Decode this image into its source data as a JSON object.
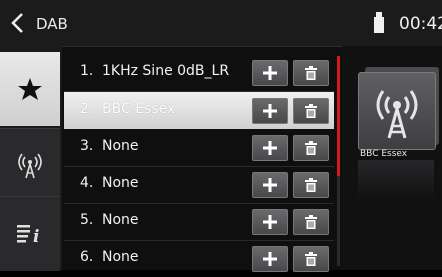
{
  "header": {
    "title": "DAB",
    "time": "00:42"
  },
  "sidebar": {
    "tabs": [
      {
        "icon": "star-icon",
        "active": true
      },
      {
        "icon": "antenna-icon",
        "active": false
      },
      {
        "icon": "list-info-icon",
        "active": false
      }
    ]
  },
  "presets": [
    {
      "number": "1.",
      "name": "1KHz Sine 0dB_LR",
      "selected": false
    },
    {
      "number": "2.",
      "name": "BBC Essex",
      "selected": true
    },
    {
      "number": "3.",
      "name": "None",
      "selected": false
    },
    {
      "number": "4.",
      "name": "None",
      "selected": false
    },
    {
      "number": "5.",
      "name": "None",
      "selected": false
    },
    {
      "number": "6.",
      "name": "None",
      "selected": false
    }
  ],
  "now_playing": {
    "station": "BBC Essex",
    "icon": "radio-tower-icon"
  },
  "colors": {
    "scroll_accent": "#d11a1a",
    "selected_row": "#e6e6e6"
  }
}
